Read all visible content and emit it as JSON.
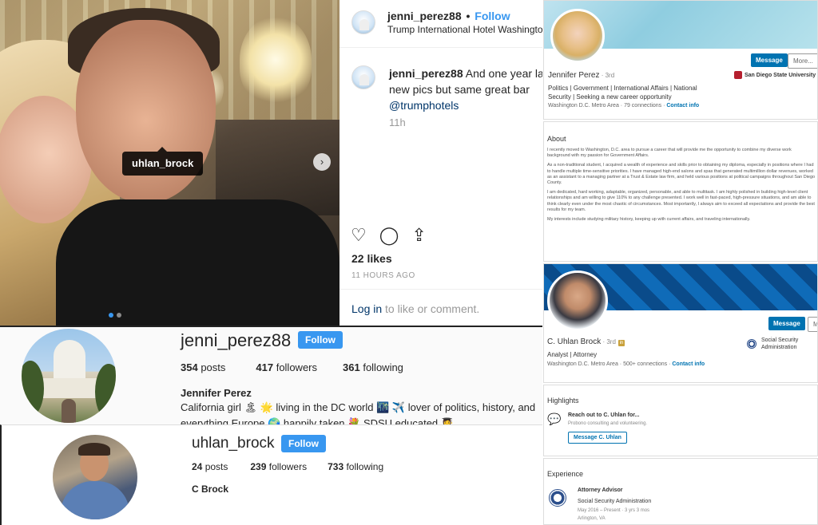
{
  "ig_post": {
    "username": "jenni_perez88",
    "follow_sep": "•",
    "follow_label": "Follow",
    "location": "Trump International Hotel Washington",
    "caption_user": "jenni_perez88",
    "caption_line1": "And one year lat",
    "caption_line2": "new pics but same great bar",
    "caption_mention": "@trumphotels",
    "comment_time": "11h",
    "likes": "22 likes",
    "time_ago": "11 HOURS AGO",
    "login_link": "Log in",
    "login_rest": " to like or comment.",
    "tag": "uhlan_brock",
    "icons": [
      "heart-icon",
      "comment-icon",
      "share-icon"
    ]
  },
  "ig_profile_jenni": {
    "username": "jenni_perez88",
    "follow_label": "Follow",
    "posts_n": "354",
    "posts_l": " posts",
    "followers_n": "417",
    "followers_l": " followers",
    "following_n": "361",
    "following_l": " following",
    "name": "Jennifer Perez",
    "bio_line1": "California girl 🏝 🌟 living in the DC world 🌃 ✈️ lover of politics, history, and",
    "bio_line2": "everything Europe 🌍 happily taken 💐 SDSU educated 👩‍🎓"
  },
  "ig_profile_uhlan": {
    "username": "uhlan_brock",
    "follow_label": "Follow",
    "posts_n": "24",
    "posts_l": " posts",
    "followers_n": "239",
    "followers_l": " followers",
    "following_n": "733",
    "following_l": " following",
    "name": "C Brock"
  },
  "li_jenni": {
    "message_label": "Message",
    "more_label": "More...",
    "name": "Jennifer Perez",
    "degree": " · 3rd",
    "headline": "Politics | Government | International Affairs | National Security | Seeking a new career opportunity",
    "location": "Washington D.C. Metro Area",
    "connections": " · 79 connections · ",
    "contact": "Contact info",
    "school": "San Diego State University",
    "about_title": "About",
    "about_paras": [
      "I recently moved to Washington, D.C. area to pursue a career that will provide me the opportunity to combine my diverse work background with my passion for Government Affairs.",
      "As a non-traditional student, I acquired a wealth of experience and skills prior to obtaining my diploma, especially in positions where I had to handle multiple time-sensitive priorities. I have managed high-end salons and spas that generated multimillion dollar revenues, worked as an assistant to a managing partner at a Trust & Estate law firm, and held various positions at political campaigns throughout San Diego County.",
      "I am dedicated, hard working, adaptable, organized, personable, and able to multitask. I am highly polished in building high-level client relationships and am willing to give 110% to any challenge presented. I work well in fast-paced, high-pressure situations, and am able to think clearly even under the most chaotic of circumstances. Most importantly, I always aim to exceed all expectations and provide the best results for my team.",
      "My interests include studying military history, keeping up with current affairs, and traveling internationally."
    ]
  },
  "li_uhlan": {
    "message_label": "Message",
    "more_label": "M",
    "name": "C. Uhlan Brock",
    "degree": " · 3rd",
    "badge": "in",
    "headline": "Analyst | Attorney",
    "location": "Washington D.C. Metro Area",
    "connections": " · 500+ connections · ",
    "contact": "Contact info",
    "org": "Social Security Administration",
    "highlights_title": "Highlights",
    "reach_title": "Reach out to C. Uhlan for...",
    "reach_sub": "Probono consulting and volunteering.",
    "reach_btn": "Message C. Uhlan",
    "experience_title": "Experience",
    "exp_role": "Attorney Advisor",
    "exp_org": "Social Security Administration",
    "exp_dates": "May 2016 – Present · 3 yrs 3 mos",
    "exp_loc": "Arlington, VA"
  },
  "colors": {
    "ig_blue": "#3897f0",
    "li_blue": "#0073b1"
  }
}
